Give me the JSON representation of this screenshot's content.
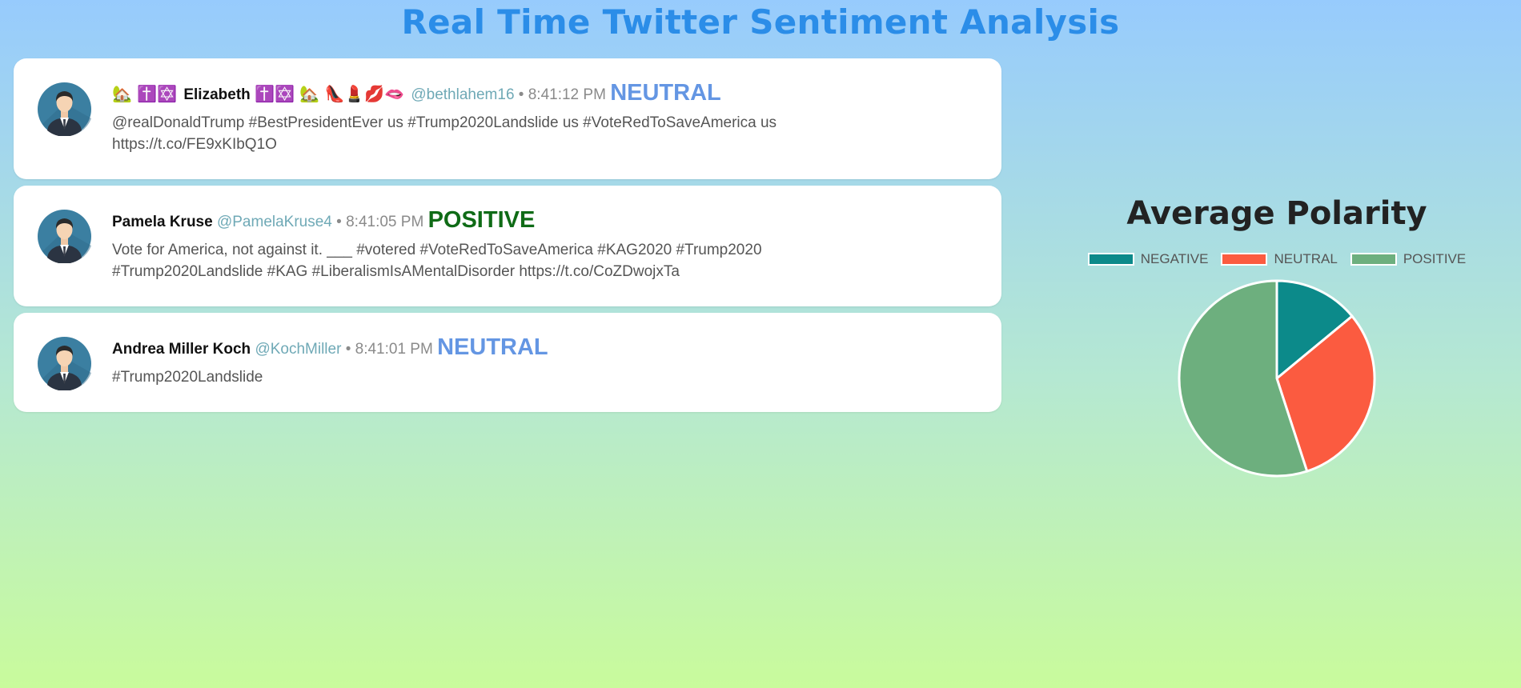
{
  "page": {
    "title": "Real Time Twitter Sentiment Analysis"
  },
  "tweets": [
    {
      "emoji_before_name": "🏡 ✝️✡️",
      "name": "Elizabeth",
      "emoji_after_name": "✝️✡️ 🏡 👠💄💋🫦",
      "handle": "@bethlahem16",
      "separator": "•",
      "time": "8:41:12 PM",
      "sentiment": "NEUTRAL",
      "text": "@realDonaldTrump #BestPresidentEver us #Trump2020Landslide us #VoteRedToSaveAmerica us https://t.co/FE9xKIbQ1O"
    },
    {
      "emoji_before_name": "",
      "name": "Pamela Kruse",
      "emoji_after_name": "",
      "handle": "@PamelaKruse4",
      "separator": "•",
      "time": "8:41:05 PM",
      "sentiment": "POSITIVE",
      "text": "Vote for America, not against it. ___ #votered #VoteRedToSaveAmerica #KAG2020 #Trump2020 #Trump2020Landslide #KAG #LiberalismIsAMentalDisorder https://t.co/CoZDwojxTa"
    },
    {
      "emoji_before_name": "",
      "name": "Andrea Miller Koch",
      "emoji_after_name": "",
      "handle": "@KochMiller",
      "separator": "•",
      "time": "8:41:01 PM",
      "sentiment": "NEUTRAL",
      "text": "#Trump2020Landslide"
    }
  ],
  "colors": {
    "negative": "#0c8a8a",
    "neutral": "#fb5b40",
    "positive": "#6daf7e",
    "neutral_label": "#6496e3",
    "positive_label": "#0f6b16"
  },
  "chart_data": {
    "type": "pie",
    "title": "Average Polarity",
    "categories": [
      "NEGATIVE",
      "NEUTRAL",
      "POSITIVE"
    ],
    "values": [
      14,
      31,
      55
    ],
    "legend_position": "top"
  }
}
